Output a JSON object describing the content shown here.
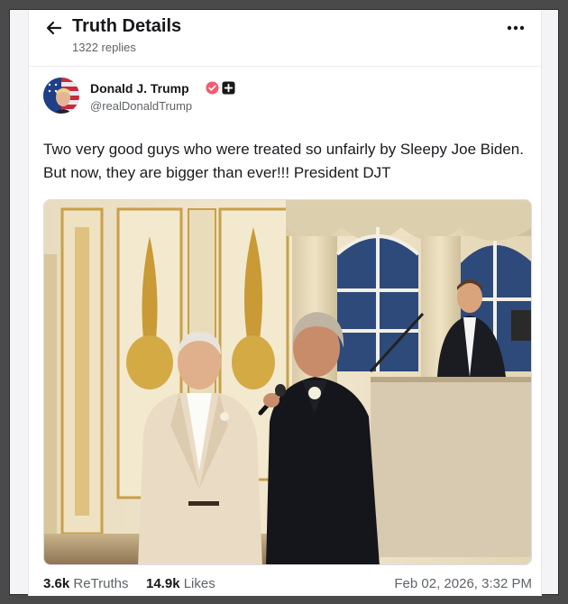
{
  "header": {
    "title": "Truth Details",
    "replies": "1322 replies"
  },
  "author": {
    "name": "Donald J. Trump",
    "handle": "@realDonaldTrump"
  },
  "post": {
    "text": "Two very good guys who were treated so unfairly by Sleepy Joe Biden. But now, they are bigger than ever!!! President DJT",
    "image_description_icon": "photo"
  },
  "stats": {
    "retruths_count": "3.6k",
    "retruths_label": "ReTruths",
    "likes_count": "14.9k",
    "likes_label": "Likes",
    "timestamp": "Feb 02, 2026, 3:32 PM"
  },
  "colors": {
    "verified": "#f25c6f",
    "accent": "#17171a"
  }
}
